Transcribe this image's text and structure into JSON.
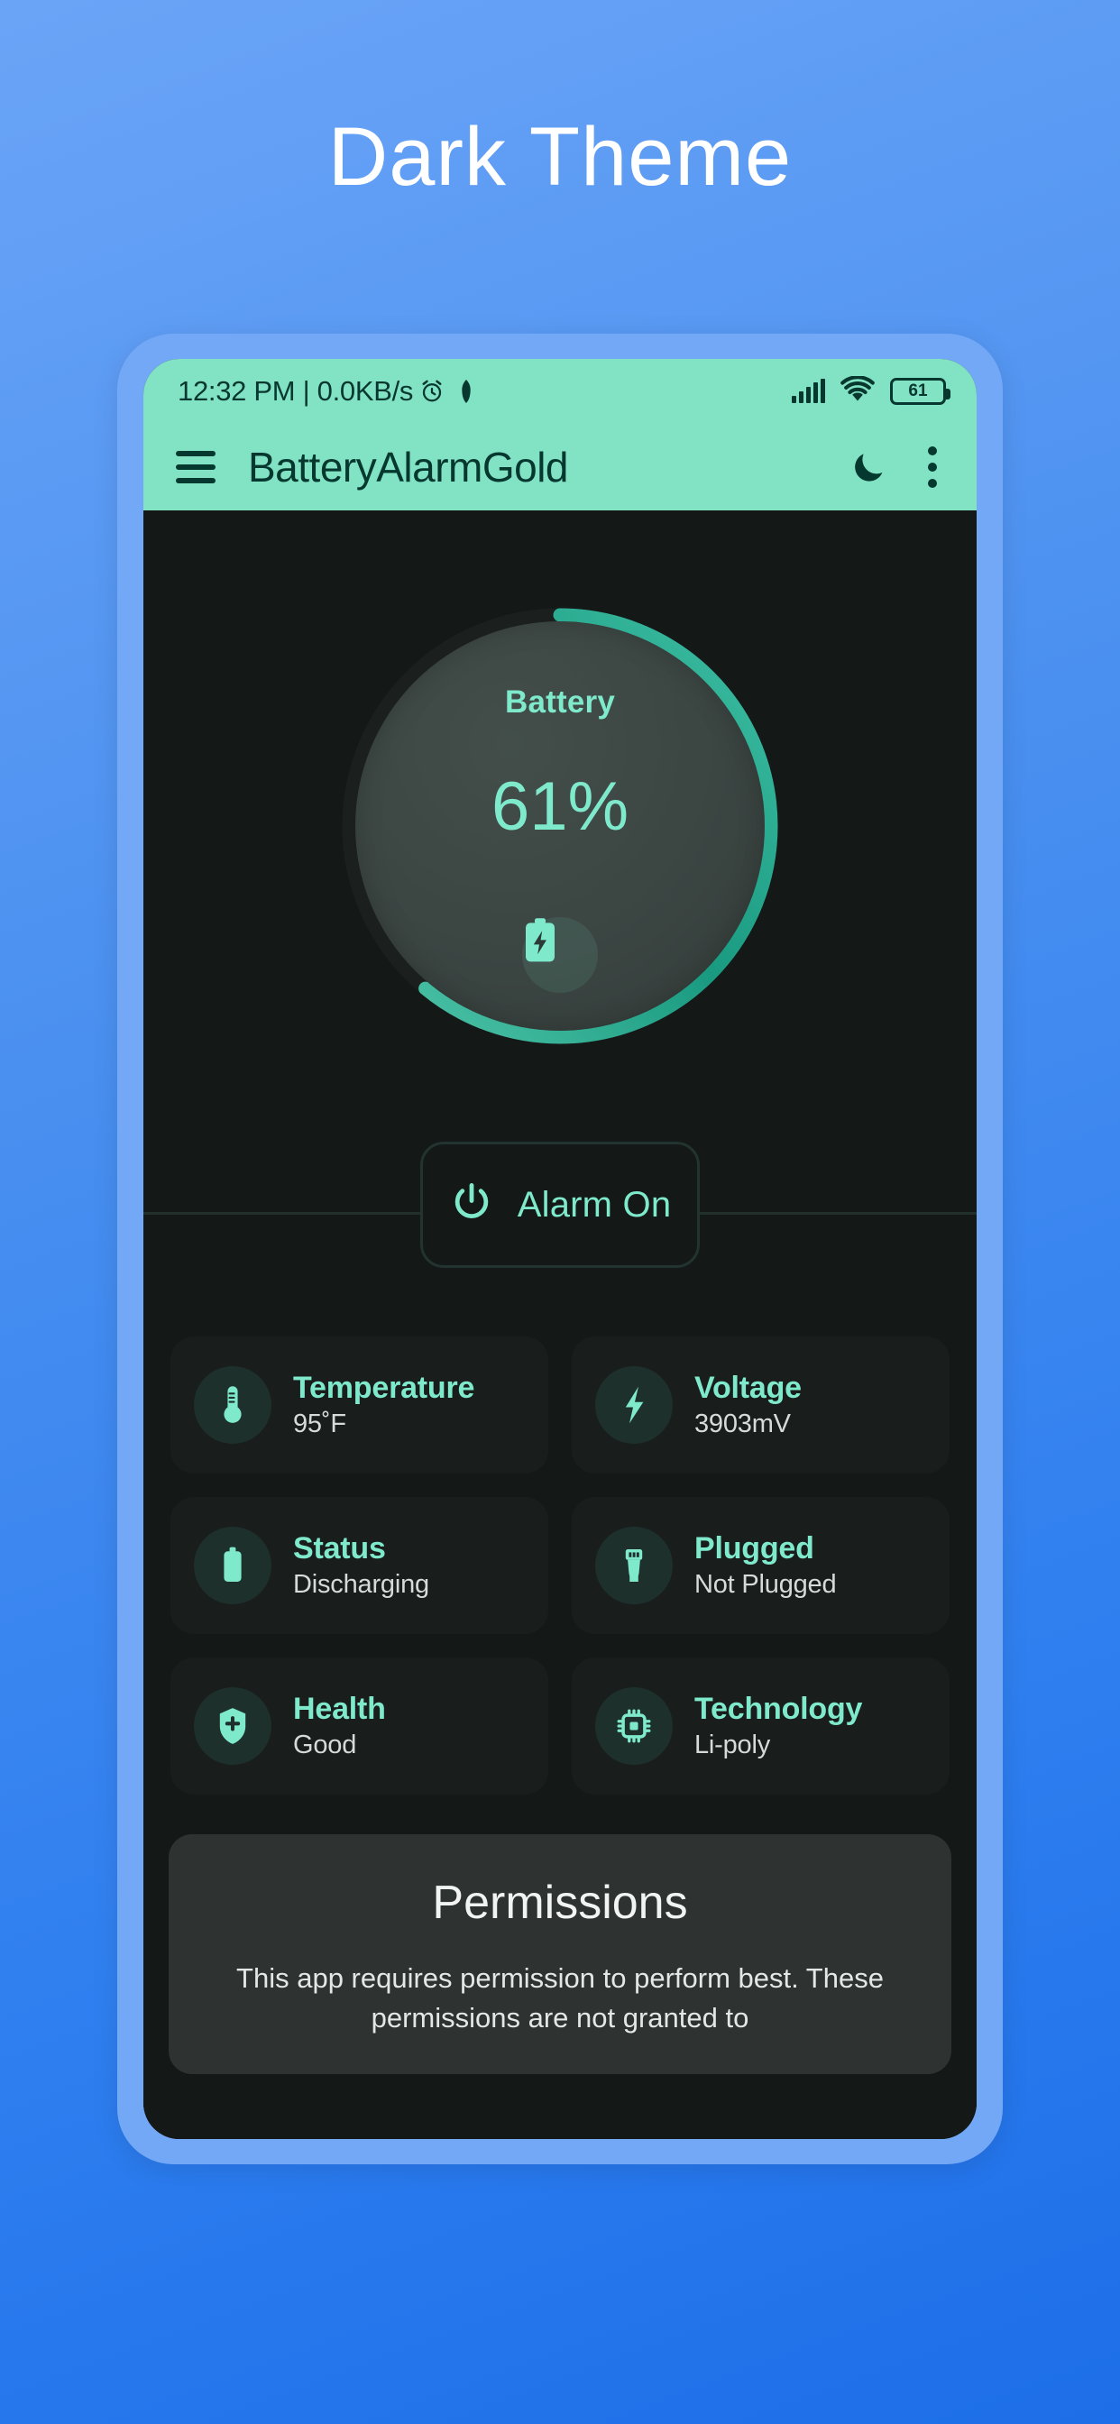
{
  "page": {
    "title": "Dark Theme"
  },
  "status_bar": {
    "text": "12:32 PM | 0.0KB/s",
    "alarm_icon": "alarm-clock-icon",
    "pin_icon": "vpn-key-icon",
    "signal_icon": "cellular-signal-icon",
    "wifi_icon": "wifi-icon",
    "battery_level": "61"
  },
  "app_bar": {
    "menu_icon": "hamburger-menu-icon",
    "title": "BatteryAlarmGold",
    "theme_icon": "moon-icon",
    "overflow_icon": "three-dot-menu-icon"
  },
  "gauge": {
    "label": "Battery",
    "value": "61%",
    "percent": 61,
    "badge_icon": "battery-charging-icon",
    "arc_color": "#21a18a",
    "track_color": "#3b4542",
    "text_color": "#7fe9cb"
  },
  "alarm_button": {
    "label": "Alarm On",
    "icon": "power-icon"
  },
  "cards": [
    {
      "icon": "thermometer-icon",
      "title": "Temperature",
      "value": "95˚F"
    },
    {
      "icon": "lightning-bolt-icon",
      "title": "Voltage",
      "value": "3903mV"
    },
    {
      "icon": "battery-icon",
      "title": "Status",
      "value": "Discharging"
    },
    {
      "icon": "usb-plug-icon",
      "title": "Plugged",
      "value": "Not Plugged"
    },
    {
      "icon": "shield-plus-icon",
      "title": "Health",
      "value": "Good"
    },
    {
      "icon": "cpu-chip-icon",
      "title": "Technology",
      "value": "Li-poly"
    }
  ],
  "permissions": {
    "title": "Permissions",
    "body": "This app requires permission to perform best. These permissions are not granted to"
  },
  "colors": {
    "background_blue": "#4a90f0",
    "frame_blue": "#73a8f6",
    "accent_mint": "#82e3c4",
    "accent_dark_teal": "#05382e",
    "screen_dark": "#141817"
  }
}
